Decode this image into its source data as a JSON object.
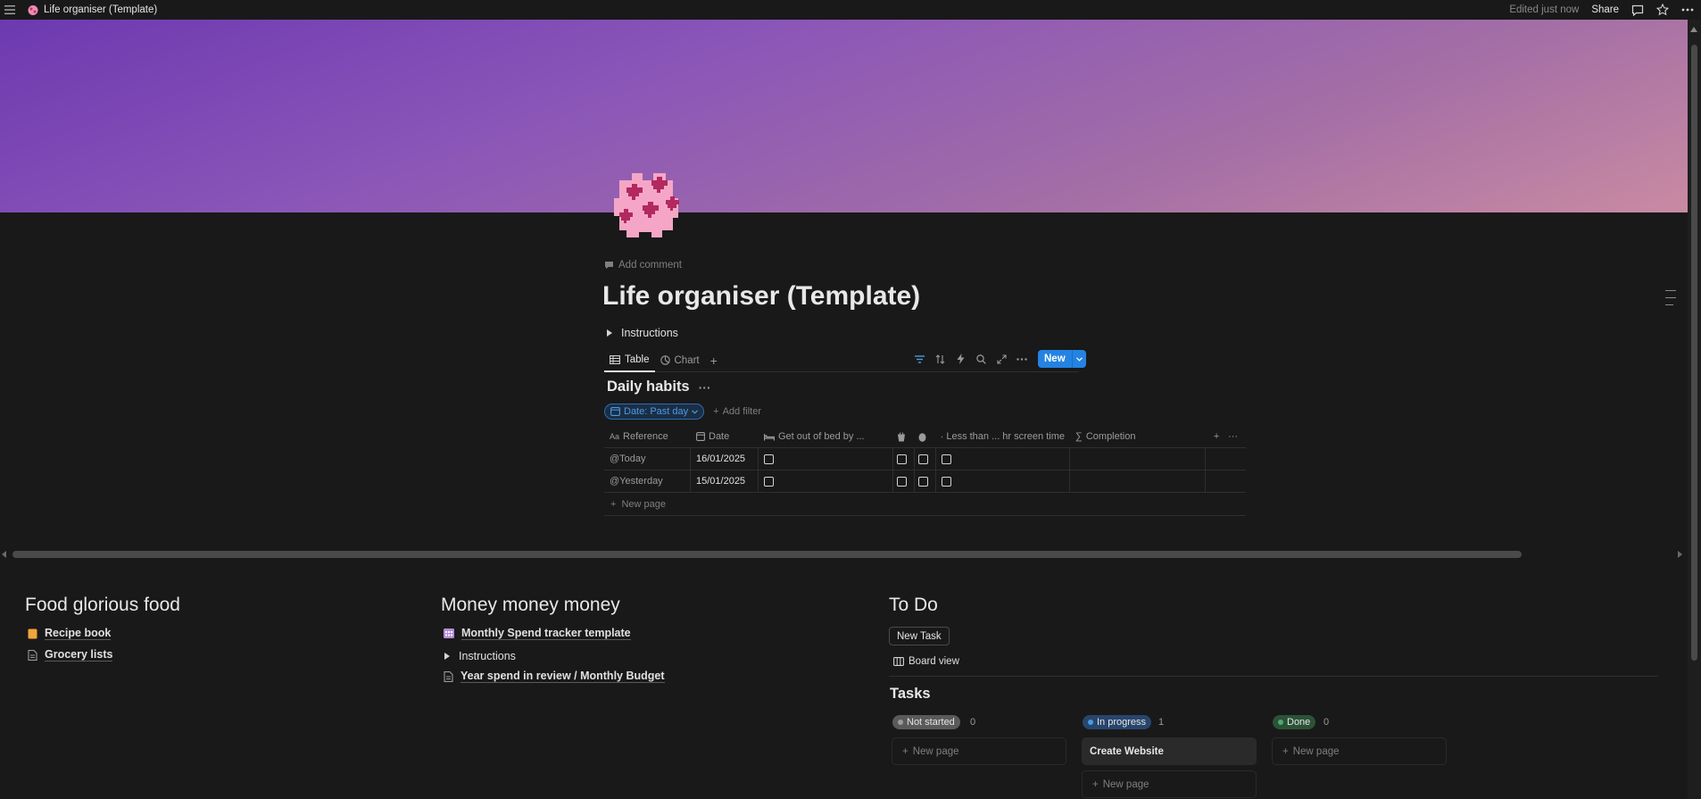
{
  "topbar": {
    "title": "Life organiser (Template)",
    "edited": "Edited just now",
    "share": "Share"
  },
  "page": {
    "add_comment": "Add comment",
    "title": "Life organiser (Template)",
    "instructions": "Instructions"
  },
  "views": {
    "tabs": [
      "Table",
      "Chart"
    ],
    "new_label": "New"
  },
  "database": {
    "title": "Daily habits",
    "filter_chip": "Date: Past day",
    "add_filter": "Add filter",
    "columns": {
      "reference": "Reference",
      "date": "Date",
      "get_out": "Get out of bed by ...",
      "screen": "Less than ... hr screen time",
      "completion": "Completion"
    },
    "rows": [
      {
        "reference": "@Today",
        "date": "16/01/2025"
      },
      {
        "reference": "@Yesterday",
        "date": "15/01/2025"
      }
    ],
    "new_page": "New page"
  },
  "food": {
    "heading": "Food glorious food",
    "items": [
      "Recipe book",
      "Grocery lists"
    ]
  },
  "money": {
    "heading": "Money money money",
    "items": [
      "Monthly Spend tracker template",
      "Instructions",
      "Year spend in review / Monthly Budget"
    ]
  },
  "todo": {
    "heading": "To Do",
    "new_task": "New Task",
    "board_view": "Board view",
    "tasks_title": "Tasks",
    "groups": [
      {
        "label": "Not started",
        "count": "0",
        "color": "#5a5a5a",
        "dot": "#9b9b9b"
      },
      {
        "label": "In progress",
        "count": "1",
        "color": "#28456c",
        "dot": "#4a9be6"
      },
      {
        "label": "Done",
        "count": "0",
        "color": "#2b5237",
        "dot": "#4dab6f"
      }
    ],
    "new_page": "New page",
    "card": "Create Website"
  }
}
